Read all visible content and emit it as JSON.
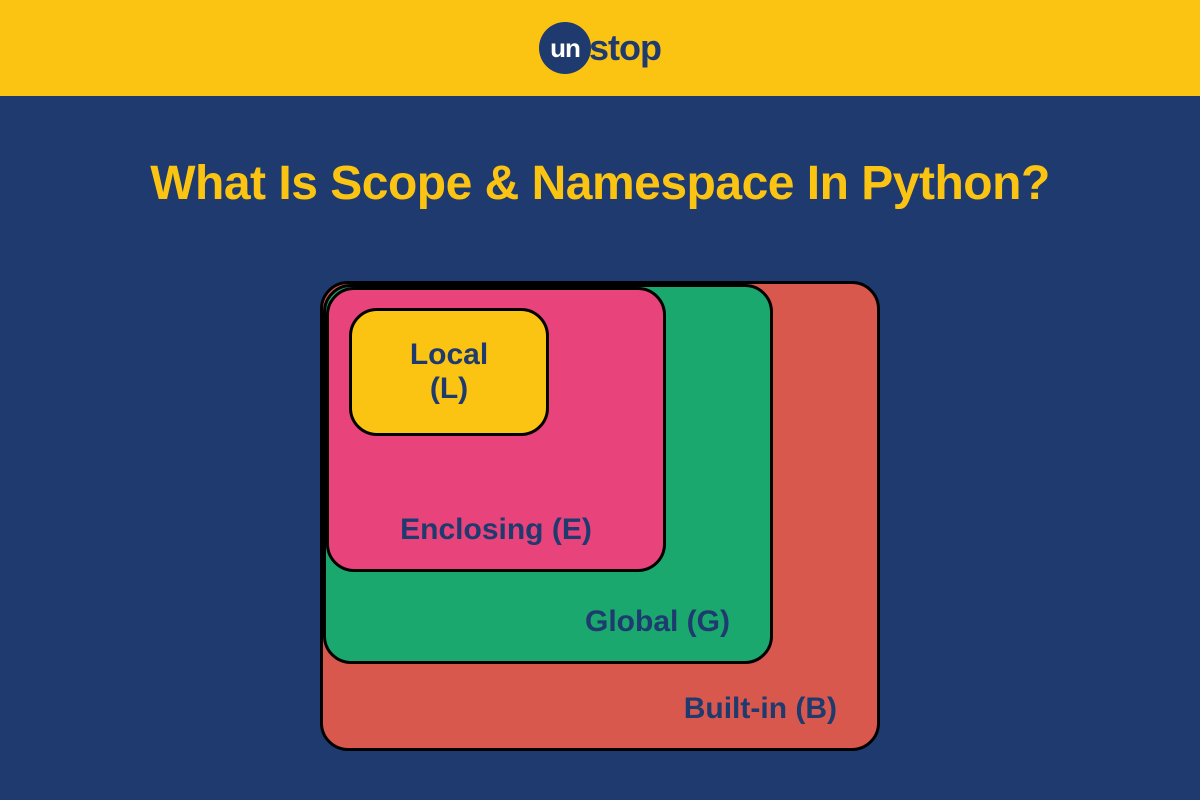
{
  "brand": {
    "circle_text": "un",
    "suffix_text": "stop"
  },
  "title": "What Is Scope & Namespace In Python?",
  "scopes": {
    "local": "Local\n(L)",
    "enclosing": "Enclosing (E)",
    "global": "Global (G)",
    "builtin": "Built-in (B)"
  },
  "colors": {
    "header": "#fbc412",
    "background": "#1e3a6e",
    "local": "#fbc412",
    "enclosing": "#e8437a",
    "global": "#1aa86f",
    "builtin": "#d9584e",
    "title": "#fbc412",
    "label": "#1e3a6e"
  }
}
